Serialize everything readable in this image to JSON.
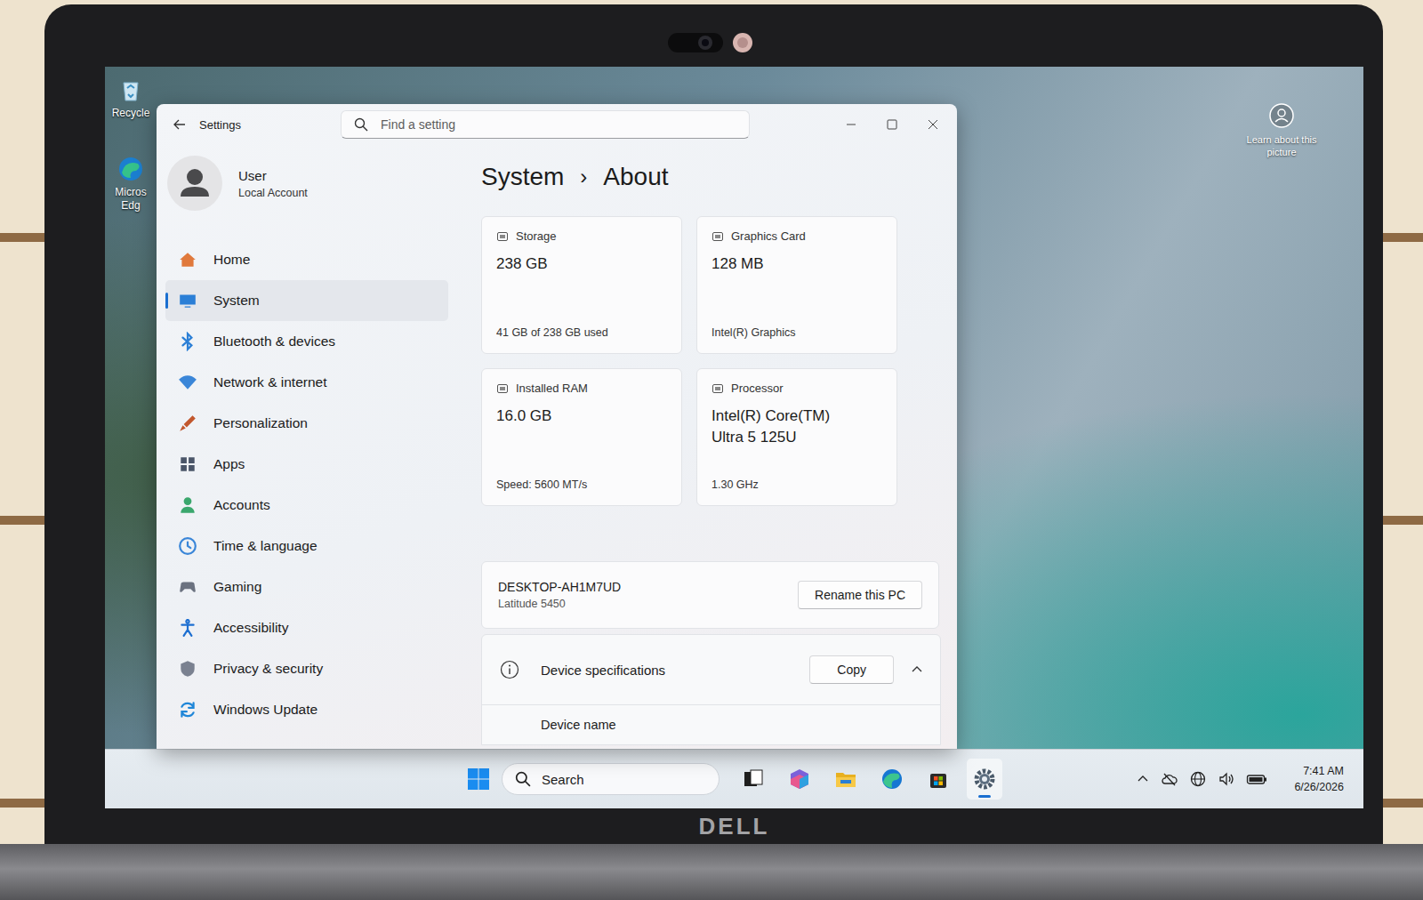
{
  "desktop": {
    "icons": [
      {
        "lines": [
          "Recycle"
        ]
      },
      {
        "lines": [
          "Micros",
          "Edg"
        ]
      }
    ],
    "spotlight": {
      "label": "Learn about this picture"
    }
  },
  "window": {
    "title": "Settings",
    "search": {
      "placeholder": "Find a setting"
    }
  },
  "account": {
    "name": "User",
    "type": "Local Account"
  },
  "sidebar": {
    "items": [
      {
        "label": "Home",
        "selected": false
      },
      {
        "label": "System",
        "selected": true
      },
      {
        "label": "Bluetooth & devices",
        "selected": false
      },
      {
        "label": "Network & internet",
        "selected": false
      },
      {
        "label": "Personalization",
        "selected": false
      },
      {
        "label": "Apps",
        "selected": false
      },
      {
        "label": "Accounts",
        "selected": false
      },
      {
        "label": "Time & language",
        "selected": false
      },
      {
        "label": "Gaming",
        "selected": false
      },
      {
        "label": "Accessibility",
        "selected": false
      },
      {
        "label": "Privacy & security",
        "selected": false
      },
      {
        "label": "Windows Update",
        "selected": false
      }
    ]
  },
  "breadcrumb": {
    "parent": "System",
    "separator": "›",
    "current": "About"
  },
  "cards": [
    {
      "label": "Storage",
      "value": [
        "238 GB"
      ],
      "detail": "41 GB of 238 GB used"
    },
    {
      "label": "Graphics Card",
      "value": [
        "128 MB"
      ],
      "detail": "Intel(R) Graphics"
    },
    {
      "label": "Installed RAM",
      "value": [
        "16.0 GB"
      ],
      "detail": "Speed: 5600 MT/s"
    },
    {
      "label": "Processor",
      "value": [
        "Intel(R) Core(TM)",
        "Ultra 5 125U"
      ],
      "detail": "1.30 GHz"
    }
  ],
  "device": {
    "name": "DESKTOP-AH1M7UD",
    "model": "Latitude 5450",
    "button": "Rename this PC"
  },
  "specifications": {
    "title": "Device specifications",
    "button": "Copy",
    "expanded": true,
    "rows": [
      {
        "label": "Device name"
      }
    ]
  },
  "taskbar": {
    "search": "Search",
    "apps": [
      {
        "active": false
      },
      {
        "active": false
      },
      {
        "active": false
      },
      {
        "active": false
      },
      {
        "active": false
      },
      {
        "active": true
      }
    ]
  },
  "clock": {
    "time": "7:41 AM",
    "date": "6/26/2026"
  },
  "brand": "DELL"
}
